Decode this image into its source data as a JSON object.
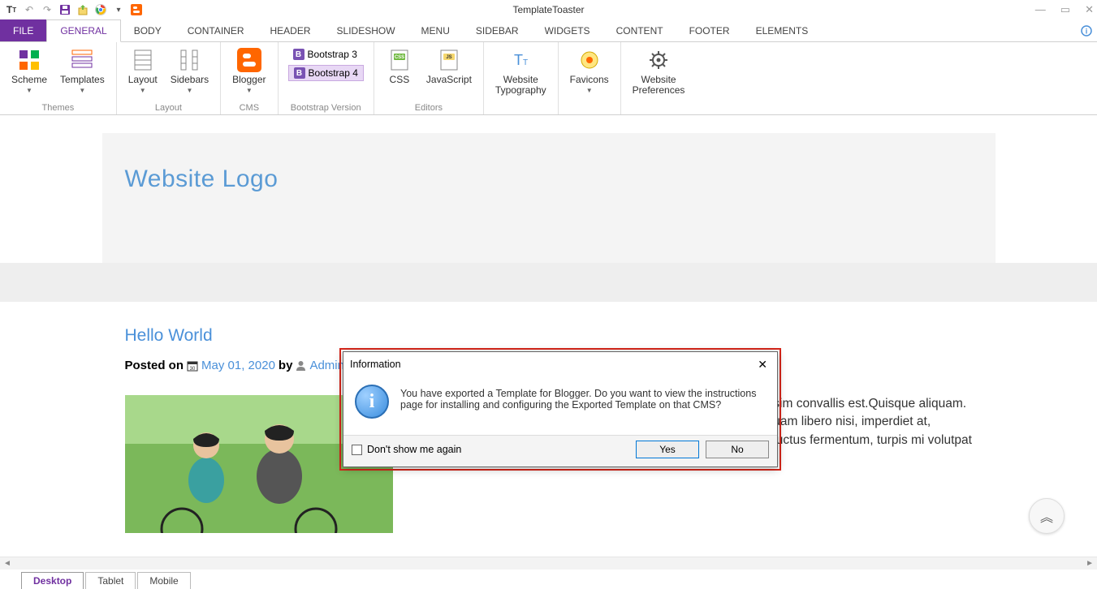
{
  "app": {
    "title": "TemplateToaster"
  },
  "qat": {
    "tt": "Tᴛ",
    "chrome": "chrome",
    "blogger": "blogger"
  },
  "tabs": {
    "file": "FILE",
    "items": [
      "GENERAL",
      "BODY",
      "CONTAINER",
      "HEADER",
      "SLIDESHOW",
      "MENU",
      "SIDEBAR",
      "WIDGETS",
      "CONTENT",
      "FOOTER",
      "ELEMENTS"
    ],
    "active_index": 0
  },
  "ribbon": {
    "themes": {
      "label": "Themes",
      "scheme": "Scheme",
      "templates": "Templates"
    },
    "layout": {
      "label": "Layout",
      "layout_btn": "Layout",
      "sidebars_btn": "Sidebars"
    },
    "cms": {
      "label": "CMS",
      "blogger": "Blogger"
    },
    "bootstrap": {
      "label": "Bootstrap Version",
      "b3": "Bootstrap 3",
      "b4": "Bootstrap 4"
    },
    "editors": {
      "label": "Editors",
      "css": "CSS",
      "js": "JavaScript"
    },
    "typography": {
      "label1": "Website",
      "label2": "Typography"
    },
    "favicons": "Favicons",
    "prefs": {
      "label1": "Website",
      "label2": "Preferences"
    }
  },
  "site": {
    "logo": "Website Logo",
    "post_title": "Hello World",
    "posted_on_label": "Posted on",
    "date": "May 01, 2020",
    "by_label": "by",
    "author": "Administrator",
    "body": "Lorem ipsum dolor sit amet, test link adipiscing elit.Nullam dignissim convallis est.Quisque aliquam. Donec faucibus. Nunc iaculis suscipit dui.Nam sit amet sem. Aliquam libero nisi, imperdiet at, tincidunt nec, gravida vehicula, nisl.Praesent mattis, massa quis luctus fermentum, turpis mi volutpat justo, eu volutpat enim diam eget metus.Maecenas ornare tortor."
  },
  "dialog": {
    "title": "Information",
    "message": "You have exported a Template for Blogger. Do you want to view the instructions page for installing and configuring the Exported Template on that CMS?",
    "dont_show": "Don't show me again",
    "yes": "Yes",
    "no": "No"
  },
  "view_tabs": {
    "desktop": "Desktop",
    "tablet": "Tablet",
    "mobile": "Mobile"
  }
}
